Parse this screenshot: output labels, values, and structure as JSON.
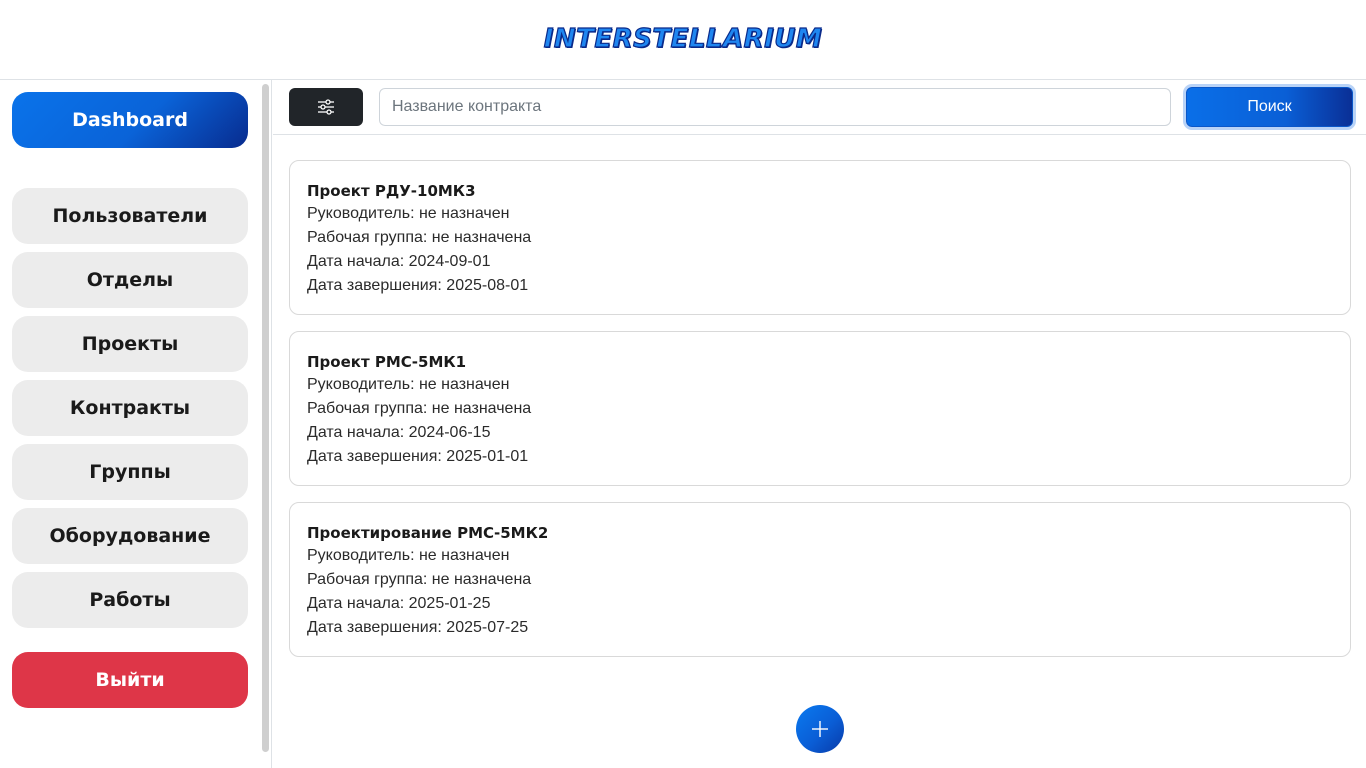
{
  "header": {
    "logo_text": "INTERSTELLARIUM"
  },
  "sidebar": {
    "dashboard": "Dashboard",
    "items": [
      {
        "label": "Пользователи"
      },
      {
        "label": "Отделы"
      },
      {
        "label": "Проекты"
      },
      {
        "label": "Контракты"
      },
      {
        "label": "Группы"
      },
      {
        "label": "Оборудование"
      },
      {
        "label": "Работы"
      }
    ],
    "logout": "Выйти"
  },
  "toolbar": {
    "filter_icon": "sliders-icon",
    "search_placeholder": "Название контракта",
    "search_value": "",
    "search_button": "Поиск"
  },
  "cards": [
    {
      "title": "Проект РДУ-10МК3",
      "manager": "Руководитель: не назначен",
      "group": "Рабочая группа: не назначена",
      "start": "Дата начала: 2024-09-01",
      "end": "Дата завершения: 2025-08-01"
    },
    {
      "title": "Проект РМС-5МК1",
      "manager": "Руководитель: не назначен",
      "group": "Рабочая группа: не назначена",
      "start": "Дата начала: 2024-06-15",
      "end": "Дата завершения: 2025-01-01"
    },
    {
      "title": "Проектирование РМС-5МК2",
      "manager": "Руководитель: не назначен",
      "group": "Рабочая группа: не назначена",
      "start": "Дата начала: 2025-01-25",
      "end": "Дата завершения: 2025-07-25"
    }
  ],
  "add_button": {
    "icon": "plus-icon"
  },
  "colors": {
    "accent": "#0a6fe8",
    "accent_dark": "#082b8e",
    "logout": "#de3648",
    "nav_bg": "#ececec",
    "filter_bg": "#212529"
  }
}
